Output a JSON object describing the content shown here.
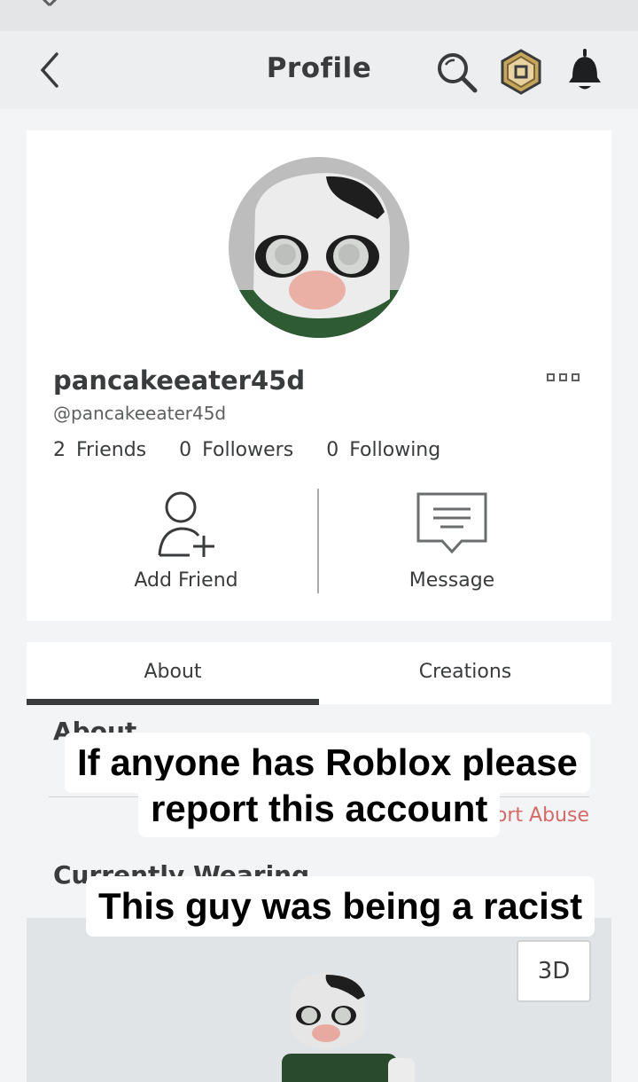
{
  "nav": {
    "title": "Profile"
  },
  "profile": {
    "display_name": "pancakeeater45d",
    "handle": "@pancakeeater45d",
    "friends_count": "2",
    "friends_label": "Friends",
    "followers_count": "0",
    "followers_label": "Followers",
    "following_count": "0",
    "following_label": "Following"
  },
  "actions": {
    "add_friend": "Add Friend",
    "message": "Message"
  },
  "tabs": [
    {
      "label": "About",
      "active": true
    },
    {
      "label": "Creations",
      "active": false
    }
  ],
  "sections": {
    "about_title": "About",
    "report_abuse": "Report Abuse",
    "currently_wearing": "Currently Wearing"
  },
  "viewer": {
    "toggle_label": "3D"
  },
  "overlay_captions": [
    "If anyone has Roblox please",
    "report this account",
    "This guy was being a racist"
  ],
  "icons": {
    "back": "chevron-left-icon",
    "search": "search-icon",
    "robux": "robux-icon",
    "notifications": "bell-icon",
    "more": "more-options-icon",
    "add_friend": "add-friend-icon",
    "message": "message-icon"
  },
  "colors": {
    "report": "#d86868",
    "active_tab": "#393b3d"
  }
}
